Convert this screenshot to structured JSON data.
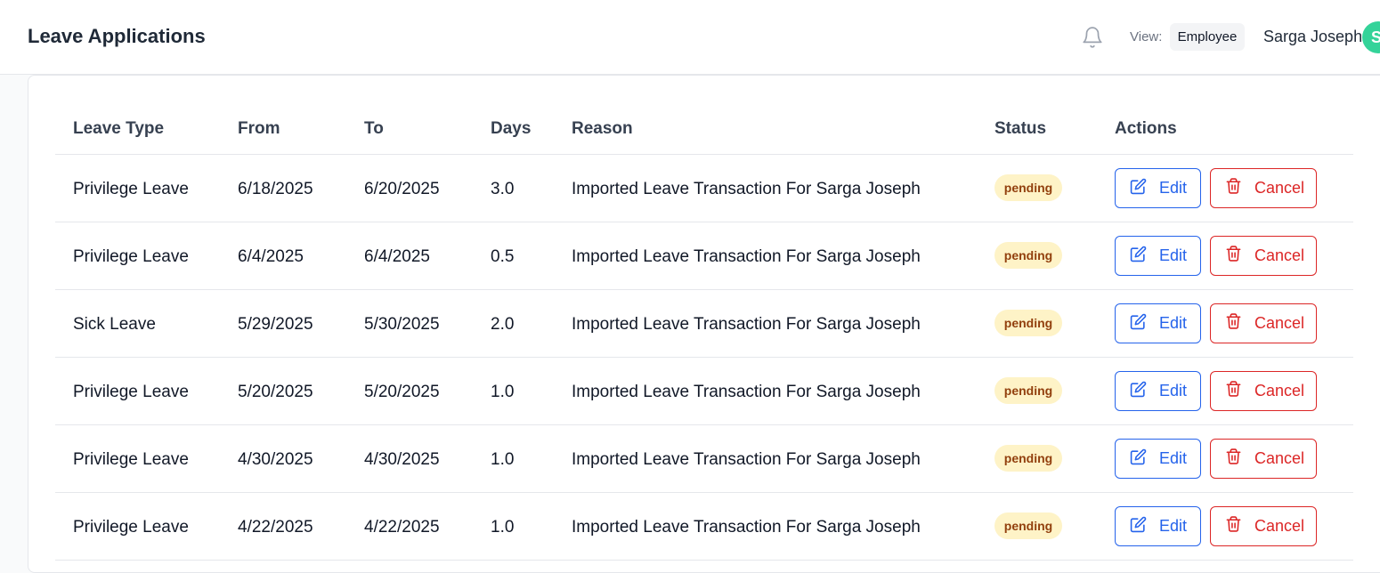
{
  "header": {
    "title": "Leave Applications",
    "view_label": "View:",
    "view_value": "Employee",
    "user_name": "Sarga Joseph",
    "avatar_letter": "S",
    "notification_icon": "bell-icon"
  },
  "colors": {
    "accent_blue": "#2563eb",
    "danger_red": "#dc2626",
    "pending_bg": "#fef3c7",
    "pending_text": "#92400e",
    "avatar_bg": "#34d399"
  },
  "table": {
    "columns": [
      "Leave Type",
      "From",
      "To",
      "Days",
      "Reason",
      "Status",
      "Actions"
    ],
    "edit_label": "Edit",
    "cancel_label": "Cancel",
    "rows": [
      {
        "type": "Privilege Leave",
        "from": "6/18/2025",
        "to": "6/20/2025",
        "days": "3.0",
        "reason": "Imported Leave Transaction For Sarga Joseph",
        "status": "pending"
      },
      {
        "type": "Privilege Leave",
        "from": "6/4/2025",
        "to": "6/4/2025",
        "days": "0.5",
        "reason": "Imported Leave Transaction For Sarga Joseph",
        "status": "pending"
      },
      {
        "type": "Sick Leave",
        "from": "5/29/2025",
        "to": "5/30/2025",
        "days": "2.0",
        "reason": "Imported Leave Transaction For Sarga Joseph",
        "status": "pending"
      },
      {
        "type": "Privilege Leave",
        "from": "5/20/2025",
        "to": "5/20/2025",
        "days": "1.0",
        "reason": "Imported Leave Transaction For Sarga Joseph",
        "status": "pending"
      },
      {
        "type": "Privilege Leave",
        "from": "4/30/2025",
        "to": "4/30/2025",
        "days": "1.0",
        "reason": "Imported Leave Transaction For Sarga Joseph",
        "status": "pending"
      },
      {
        "type": "Privilege Leave",
        "from": "4/22/2025",
        "to": "4/22/2025",
        "days": "1.0",
        "reason": "Imported Leave Transaction For Sarga Joseph",
        "status": "pending"
      }
    ]
  }
}
